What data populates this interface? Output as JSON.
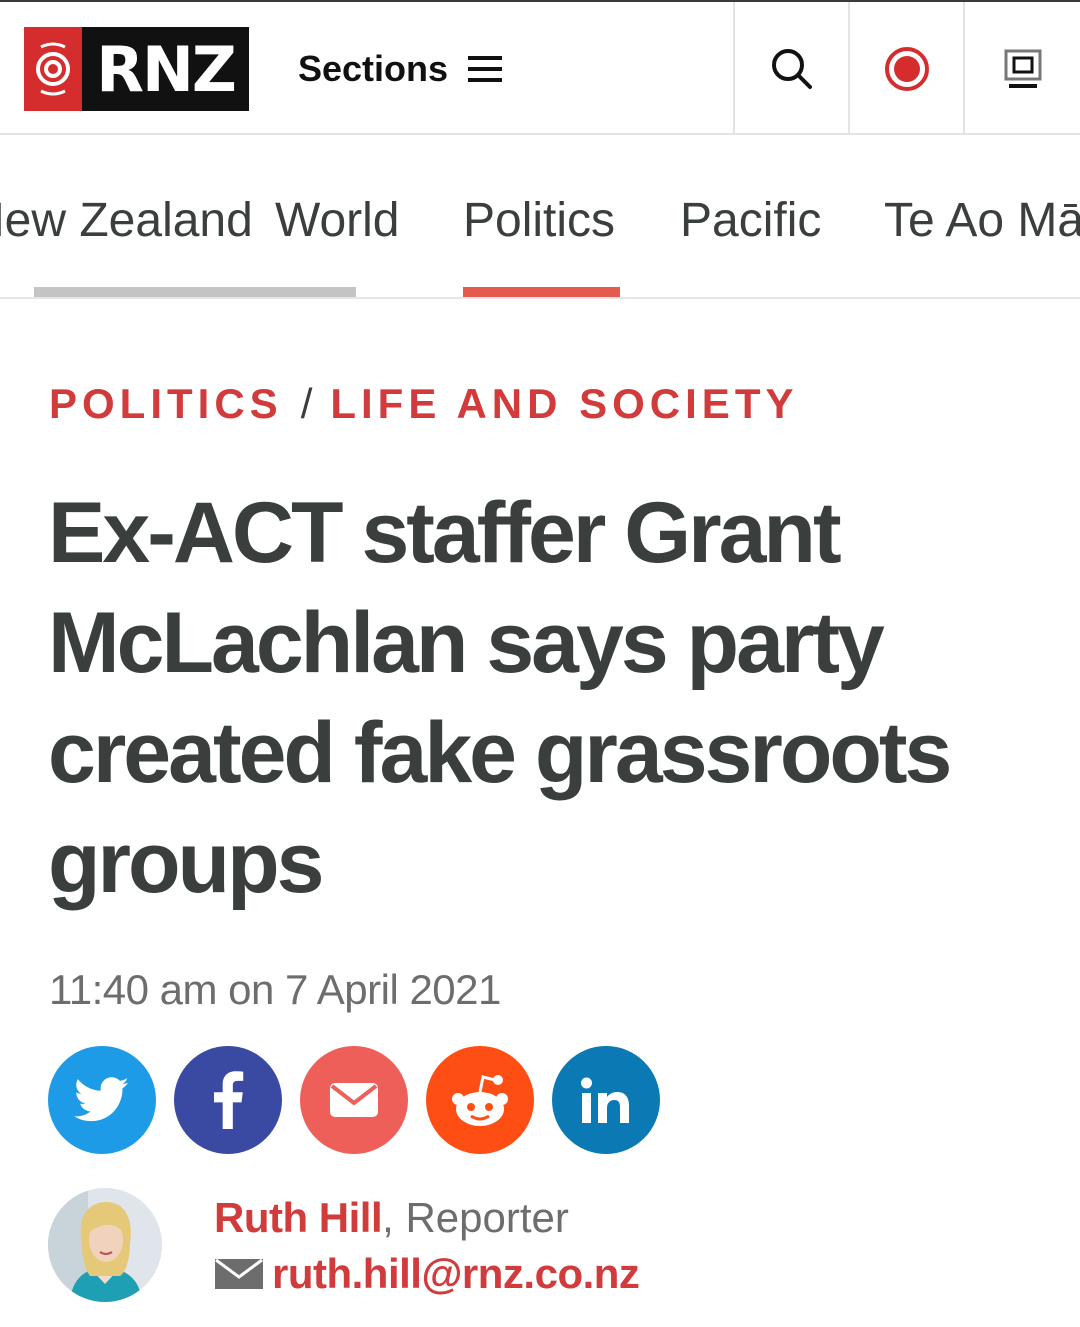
{
  "header": {
    "logo_text": "RNZ",
    "sections_label": "Sections",
    "icons": {
      "search": "search-icon",
      "live": "live-radio-icon",
      "screen": "screen-icon",
      "menu": "hamburger-icon"
    },
    "brand_red": "#d52d2d"
  },
  "nav": {
    "tabs": [
      {
        "label": "New Zealand",
        "indicator": "gray"
      },
      {
        "label": "World",
        "indicator": "none"
      },
      {
        "label": "Politics",
        "indicator": "red",
        "active": true
      },
      {
        "label": "Pacific",
        "indicator": "none"
      },
      {
        "label": "Te Ao Māori",
        "indicator": "none"
      }
    ],
    "accent": "#e55a4f"
  },
  "article": {
    "kicker_primary": "POLITICS",
    "kicker_separator": "/",
    "kicker_secondary": "LIFE AND SOCIETY",
    "headline": "Ex-ACT staffer Grant McLachlan says party created fake grassroots groups",
    "dateline": "11:40 am on 7 April 2021"
  },
  "share": {
    "buttons": [
      {
        "name": "twitter",
        "icon": "twitter-icon",
        "color": "#1d9be6"
      },
      {
        "name": "facebook",
        "icon": "facebook-icon",
        "color": "#3a4aa3"
      },
      {
        "name": "email",
        "icon": "mail-icon",
        "color": "#ef5f5a"
      },
      {
        "name": "reddit",
        "icon": "reddit-icon",
        "color": "#fe4e14"
      },
      {
        "name": "linkedin",
        "icon": "linkedin-icon",
        "color": "#0a79b4"
      }
    ]
  },
  "author": {
    "name": "Ruth Hill",
    "role": ", Reporter",
    "email": "ruth.hill@rnz.co.nz"
  }
}
